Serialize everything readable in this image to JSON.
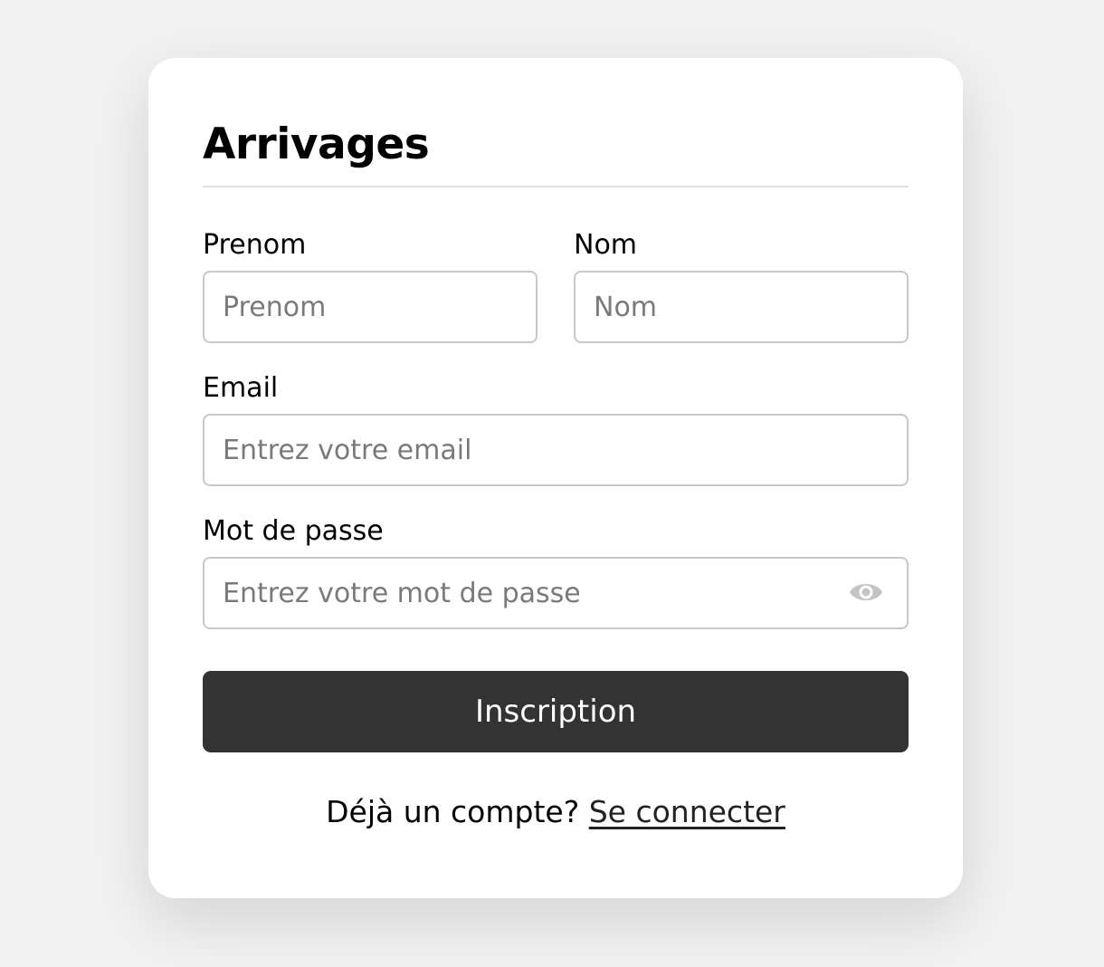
{
  "app": {
    "title": "Arrivages"
  },
  "form": {
    "first_name": {
      "label": "Prenom",
      "placeholder": "Prenom",
      "value": ""
    },
    "last_name": {
      "label": "Nom",
      "placeholder": "Nom",
      "value": ""
    },
    "email": {
      "label": "Email",
      "placeholder": "Entrez votre email",
      "value": ""
    },
    "password": {
      "label": "Mot de passe",
      "placeholder": "Entrez votre mot de passe",
      "value": "",
      "toggle_icon": "eye-icon"
    },
    "submit_label": "Inscription"
  },
  "footer": {
    "prompt": "Déjà un compte?",
    "link_label": "Se connecter"
  },
  "colors": {
    "background": "#f2f2f2",
    "card": "#ffffff",
    "button": "#333333",
    "input_border": "#c8c8c8",
    "placeholder": "#7a7a7a",
    "icon": "#c4c4c4"
  }
}
